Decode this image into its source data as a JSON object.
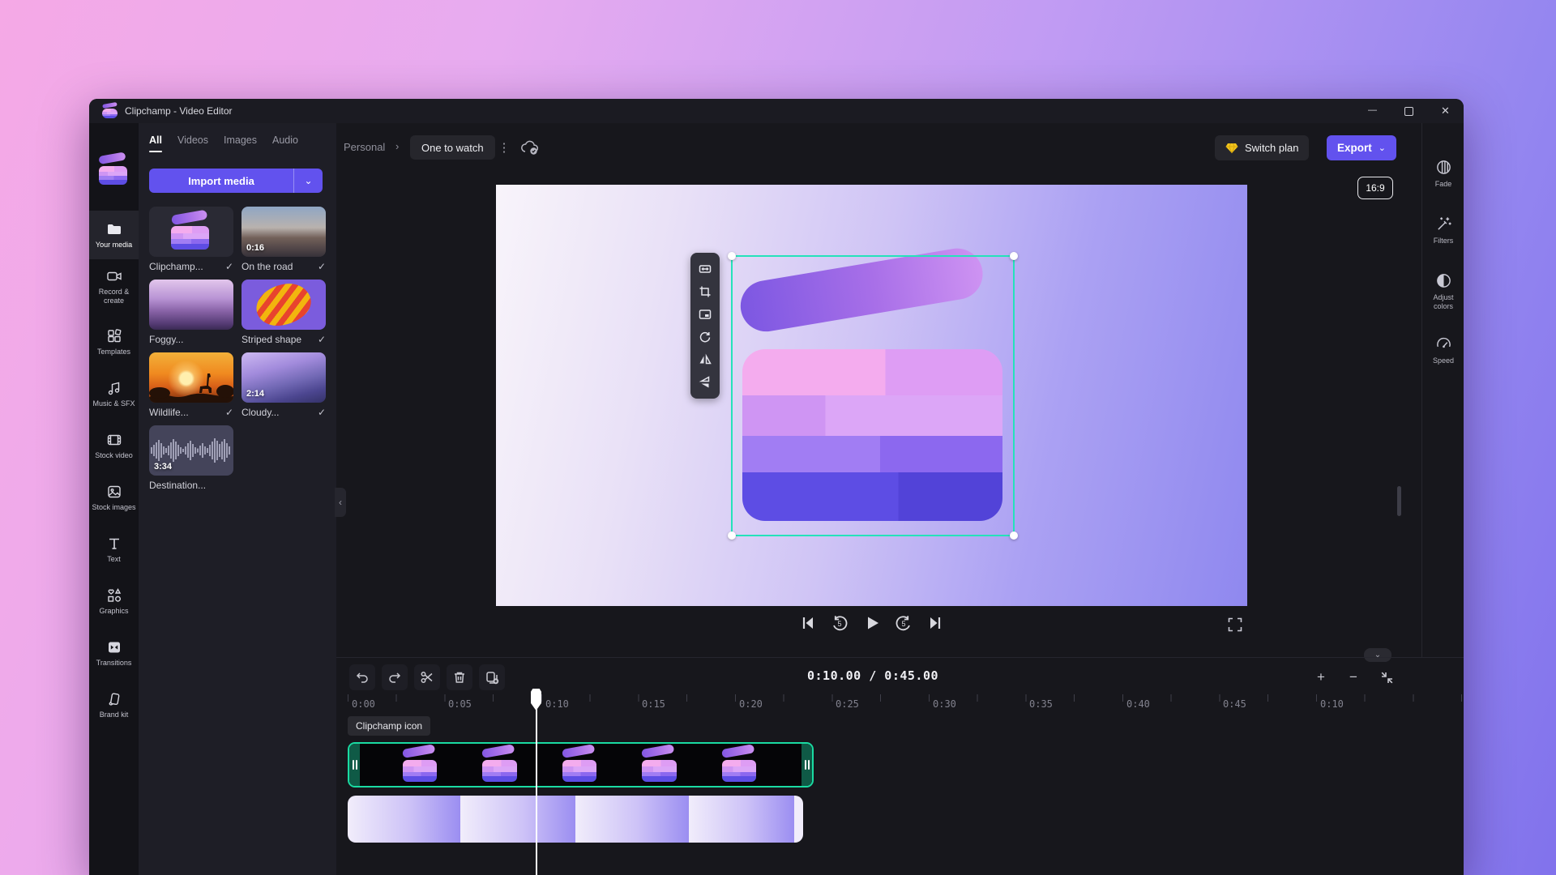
{
  "titlebar": {
    "title": "Clipchamp - Video Editor"
  },
  "header": {
    "breadcrumb_root": "Personal",
    "project_name": "One to watch",
    "switch_plan_label": "Switch plan",
    "export_label": "Export"
  },
  "rail": {
    "items": [
      {
        "label": "Your media",
        "active": true
      },
      {
        "label": "Record & create",
        "active": false
      },
      {
        "label": "Templates",
        "active": false
      },
      {
        "label": "Music & SFX",
        "active": false
      },
      {
        "label": "Stock video",
        "active": false
      },
      {
        "label": "Stock images",
        "active": false
      },
      {
        "label": "Text",
        "active": false
      },
      {
        "label": "Graphics",
        "active": false
      },
      {
        "label": "Transitions",
        "active": false
      },
      {
        "label": "Brand kit",
        "active": false
      }
    ]
  },
  "media_panel": {
    "tabs": [
      {
        "label": "All",
        "active": true
      },
      {
        "label": "Videos",
        "active": false
      },
      {
        "label": "Images",
        "active": false
      },
      {
        "label": "Audio",
        "active": false
      }
    ],
    "import_label": "Import media",
    "items": [
      {
        "label": "Clipchamp...",
        "checked": true,
        "duration": ""
      },
      {
        "label": "On the road",
        "checked": true,
        "duration": "0:16"
      },
      {
        "label": "Foggy...",
        "checked": false,
        "duration": ""
      },
      {
        "label": "Striped shape",
        "checked": true,
        "duration": ""
      },
      {
        "label": "Wildlife...",
        "checked": true,
        "duration": ""
      },
      {
        "label": "Cloudy...",
        "checked": true,
        "duration": "2:14"
      },
      {
        "label": "Destination...",
        "checked": false,
        "duration": "3:34"
      }
    ]
  },
  "preview": {
    "aspect_badge": "16:9"
  },
  "tool_rail": {
    "items": [
      {
        "label": "Fade"
      },
      {
        "label": "Filters"
      },
      {
        "label": "Adjust colors"
      },
      {
        "label": "Speed"
      }
    ]
  },
  "timeline": {
    "time_display": "0:10.00 / 0:45.00",
    "clip_tooltip": "Clipchamp icon",
    "ruler_labels": [
      "0:00",
      "0:05",
      "0:10",
      "0:15",
      "0:20",
      "0:25",
      "0:30",
      "0:35",
      "0:40",
      "0:45",
      "0:10"
    ]
  },
  "icons": {
    "check": "✓",
    "breadcrumb_chevron": "›",
    "kebab": "⋮",
    "dropdown_chevron": "⌄",
    "collapse_chevron": "‹",
    "collapse_down_chevron": "⌄",
    "plus": "+",
    "minus": "−",
    "title_minimize": "—",
    "title_close": "✕"
  },
  "colors": {
    "accent_purple": "#6252ee",
    "selection_teal": "#1adba2",
    "gem_yellow": "#f2c51d",
    "canvas_selection": "#25e2ba"
  }
}
